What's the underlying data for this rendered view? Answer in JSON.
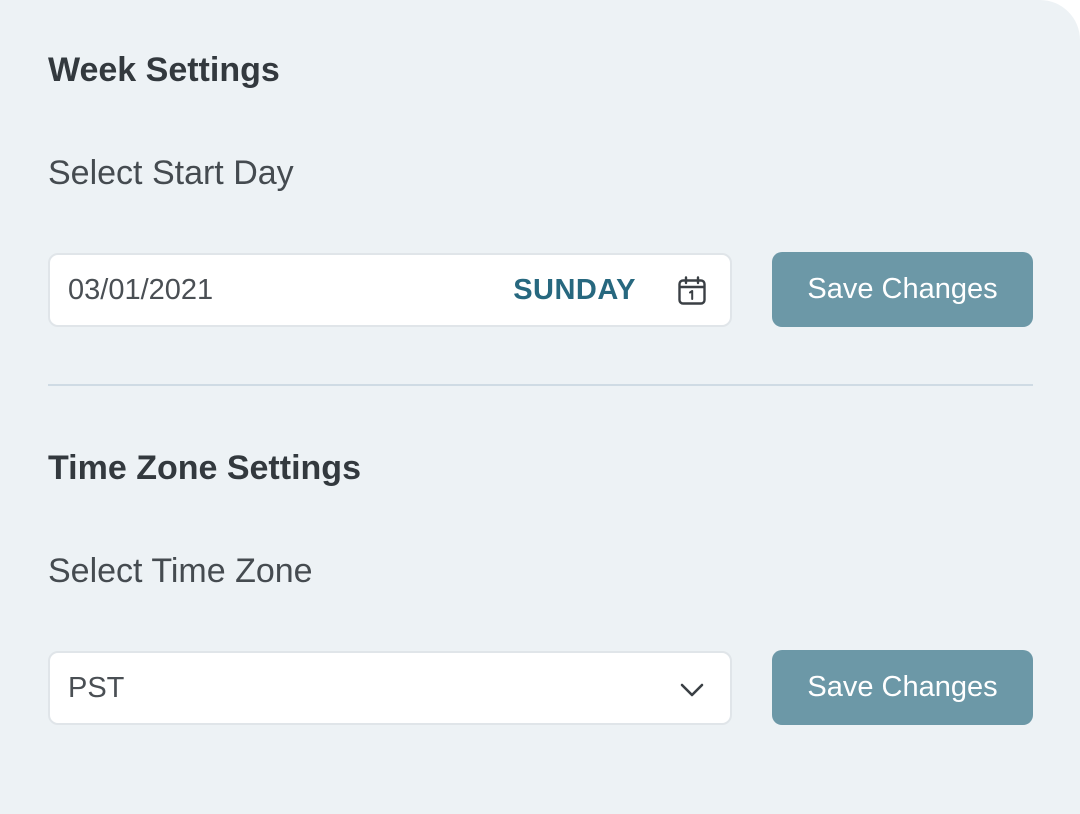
{
  "week_settings": {
    "title": "Week Settings",
    "start_day_label": "Select Start Day",
    "date_value": "03/01/2021",
    "day_name": "SUNDAY",
    "save_label": "Save Changes",
    "calendar_icon": "calendar-icon"
  },
  "time_zone_settings": {
    "title": "Time Zone Settings",
    "time_zone_label": "Select Time Zone",
    "selected_zone": "PST",
    "save_label": "Save Changes",
    "dropdown_icon": "chevron-down-icon"
  },
  "colors": {
    "background": "#edf2f5",
    "accent_button": "#6c98a7",
    "day_text": "#27687f",
    "divider": "#cfdbe4"
  }
}
